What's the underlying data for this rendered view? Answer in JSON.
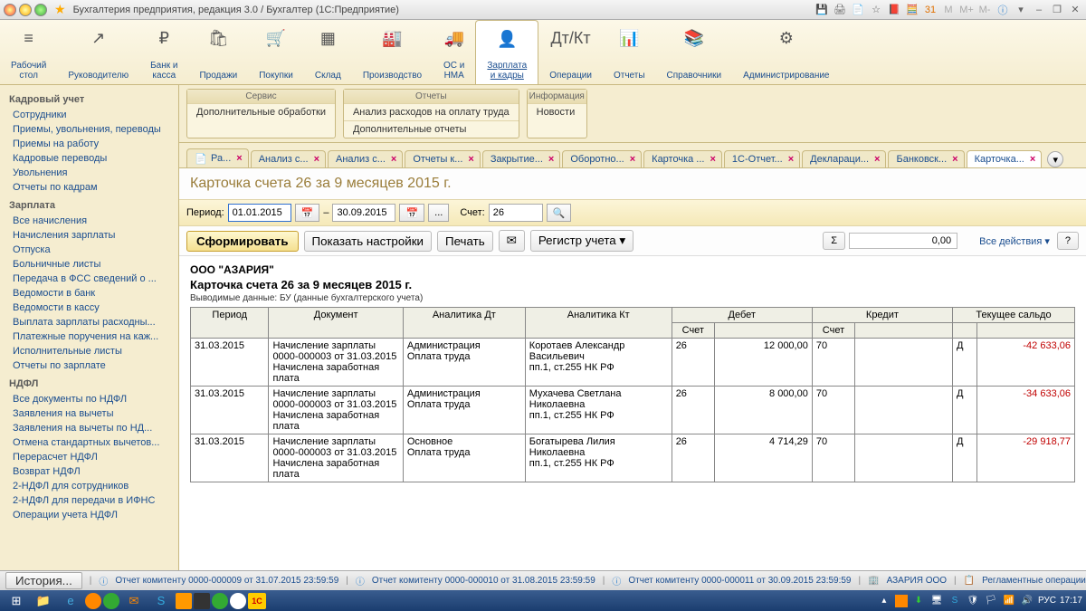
{
  "titlebar": {
    "title": "Бухгалтерия предприятия, редакция 3.0 / Бухгалтер  (1С:Предприятие)"
  },
  "nav": [
    {
      "icon": "≡",
      "label": "Рабочий\nстол"
    },
    {
      "icon": "↗",
      "label": "Руководителю"
    },
    {
      "icon": "₽",
      "label": "Банк и\nкасса"
    },
    {
      "icon": "🛍",
      "label": "Продажи"
    },
    {
      "icon": "🛒",
      "label": "Покупки"
    },
    {
      "icon": "▦",
      "label": "Склад"
    },
    {
      "icon": "🏭",
      "label": "Производство"
    },
    {
      "icon": "🚚",
      "label": "ОС и\nНМА"
    },
    {
      "icon": "👤",
      "label": "Зарплата\nи кадры",
      "active": true
    },
    {
      "icon": "Дт/Кт",
      "label": "Операции"
    },
    {
      "icon": "📊",
      "label": "Отчеты"
    },
    {
      "icon": "📚",
      "label": "Справочники"
    },
    {
      "icon": "⚙",
      "label": "Администрирование"
    }
  ],
  "sidebar": {
    "sections": [
      {
        "title": "Кадровый учет",
        "items": [
          "Сотрудники",
          "Приемы, увольнения, переводы",
          "Приемы на работу",
          "Кадровые переводы",
          "Увольнения",
          "Отчеты по кадрам"
        ]
      },
      {
        "title": "Зарплата",
        "items": [
          "Все начисления",
          "Начисления зарплаты",
          "Отпуска",
          "Больничные листы",
          "Передача в ФСС сведений о ...",
          "Ведомости в банк",
          "Ведомости в кассу",
          "Выплата зарплаты расходны...",
          "Платежные поручения на каж...",
          "Исполнительные листы",
          "Отчеты по зарплате"
        ]
      },
      {
        "title": "НДФЛ",
        "items": [
          "Все документы по НДФЛ",
          "Заявления на вычеты",
          "Заявления на вычеты по НД...",
          "Отмена стандартных вычетов...",
          "Перерасчет НДФЛ",
          "Возврат НДФЛ",
          "2-НДФЛ для сотрудников",
          "2-НДФЛ для передачи в ИФНС",
          "Операции учета НДФЛ"
        ]
      }
    ]
  },
  "panels": {
    "service": {
      "title": "Сервис",
      "items": [
        "Дополнительные обработки"
      ]
    },
    "reports": {
      "title": "Отчеты",
      "items": [
        "Анализ расходов на оплату труда",
        "Дополнительные отчеты"
      ]
    },
    "info": {
      "title": "Информация",
      "items": [
        "Новости"
      ]
    }
  },
  "tabs": [
    "Ра...",
    "Анализ с...",
    "Анализ с...",
    "Отчеты к...",
    "Закрытие...",
    "Оборотно...",
    "Карточка ...",
    "1С-Отчет...",
    "Деклараци...",
    "Банковск...",
    "Карточка..."
  ],
  "tabs_active_index": 10,
  "report": {
    "title": "Карточка счета 26 за 9 месяцев 2015 г.",
    "period_label": "Период:",
    "date_from": "01.01.2015",
    "date_to": "30.09.2015",
    "account_label": "Счет:",
    "account": "26",
    "btn_form": "Сформировать",
    "btn_settings": "Показать настройки",
    "btn_print": "Печать",
    "btn_reg": "Регистр учета",
    "sum": "0,00",
    "all_actions": "Все действия",
    "org": "ООО \"АЗАРИЯ\"",
    "subtitle": "Карточка счета 26 за 9 месяцев 2015 г.",
    "note": "Выводимые данные:  БУ (данные бухгалтерского учета)",
    "cols": {
      "period": "Период",
      "doc": "Документ",
      "an_dt": "Аналитика Дт",
      "an_kt": "Аналитика Кт",
      "debit": "Дебет",
      "credit": "Кредит",
      "balance": "Текущее сальдо",
      "acct": "Счет"
    },
    "rows": [
      {
        "period": "31.03.2015",
        "doc": "Начисление зарплаты 0000-000003 от 31.03.2015\nНачислена заработная плата",
        "an_dt": "Администрация\nОплата труда",
        "an_kt": "Коротаев Александр Васильевич\nпп.1, ст.255 НК РФ",
        "d_acct": "26",
        "d_sum": "12 000,00",
        "c_acct": "70",
        "bal_dc": "Д",
        "bal": "-42 633,06"
      },
      {
        "period": "31.03.2015",
        "doc": "Начисление зарплаты 0000-000003 от 31.03.2015\nНачислена заработная плата",
        "an_dt": "Администрация\nОплата труда",
        "an_kt": "Мухачева Светлана Николаевна\nпп.1, ст.255 НК РФ",
        "d_acct": "26",
        "d_sum": "8 000,00",
        "c_acct": "70",
        "bal_dc": "Д",
        "bal": "-34 633,06"
      },
      {
        "period": "31.03.2015",
        "doc": "Начисление зарплаты 0000-000003 от 31.03.2015\nНачислена заработная плата",
        "an_dt": "Основное\nОплата труда",
        "an_kt": "Богатырева Лилия Николаевна\nпп.1, ст.255 НК РФ",
        "d_acct": "26",
        "d_sum": "4 714,29",
        "c_acct": "70",
        "bal_dc": "Д",
        "bal": "-29 918,77"
      }
    ]
  },
  "statusbar": {
    "history": "История...",
    "items": [
      "Отчет комитенту 0000-000009 от 31.07.2015 23:59:59",
      "Отчет комитенту 0000-000010 от 31.08.2015 23:59:59",
      "Отчет комитенту 0000-000011 от 30.09.2015 23:59:59",
      "АЗАРИЯ ООО",
      "Регламентные операции"
    ]
  },
  "taskbar": {
    "time": "17:17",
    "lang": "РУС"
  }
}
